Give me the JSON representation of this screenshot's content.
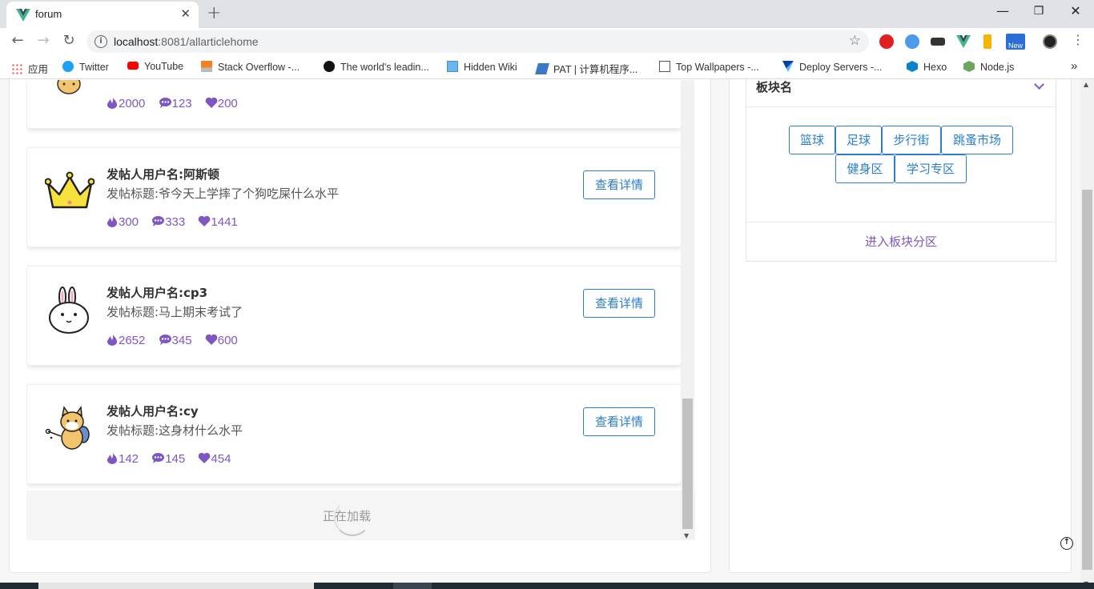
{
  "browser": {
    "tab_title": "forum",
    "url_host": "localhost",
    "url_rest": ":8081/allarticlehome",
    "bookmarks": [
      {
        "label": "应用",
        "icon": "apps-icon"
      },
      {
        "label": "Twitter",
        "icon": "twitter-icon"
      },
      {
        "label": "YouTube",
        "icon": "youtube-icon"
      },
      {
        "label": "Stack Overflow -...",
        "icon": "stackoverflow-icon"
      },
      {
        "label": "The world's leadin...",
        "icon": "github-icon"
      },
      {
        "label": "Hidden Wiki",
        "icon": "page-icon"
      },
      {
        "label": "PAT | 计算机程序...",
        "icon": "pat-icon"
      },
      {
        "label": "Top Wallpapers -...",
        "icon": "wallpaper-icon"
      },
      {
        "label": "Deploy Servers -...",
        "icon": "vultr-icon"
      },
      {
        "label": "Hexo",
        "icon": "hexo-icon"
      },
      {
        "label": "Node.js",
        "icon": "nodejs-icon"
      }
    ],
    "more_bookmarks": "»",
    "ext_new_badge": "New"
  },
  "posts": [
    {
      "user": "",
      "title": "",
      "views": "2000",
      "comments": "123",
      "likes": "200",
      "avatar": "dog-icon"
    },
    {
      "user": "发帖人用户名:阿斯顿",
      "title": "发帖标题:爷今天上学摔了个狗吃屎什么水平",
      "views": "300",
      "comments": "333",
      "likes": "1441",
      "avatar": "crown-icon"
    },
    {
      "user": "发帖人用户名:cp3",
      "title": "发帖标题:马上期末考试了",
      "views": "2652",
      "comments": "345",
      "likes": "600",
      "avatar": "rabbit-icon"
    },
    {
      "user": "发帖人用户名:cy",
      "title": "发帖标题:这身材什么水平",
      "views": "142",
      "comments": "145",
      "likes": "454",
      "avatar": "shiba-icon"
    }
  ],
  "detail_button_label": "查看详情",
  "loading_text": "正在加载",
  "board": {
    "name": "板块名",
    "tags": [
      "篮球",
      "足球",
      "步行街",
      "跳蚤市场",
      "健身区",
      "学习专区"
    ],
    "enter_label": "进入板块分区"
  },
  "colors": {
    "accent": "#7e57c2",
    "button_blue": "#2a7ed1"
  }
}
